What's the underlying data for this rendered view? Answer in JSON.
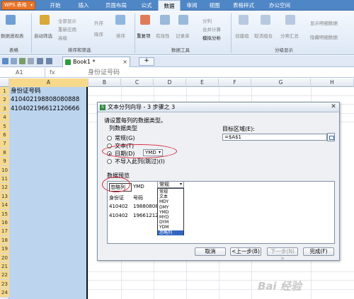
{
  "menubar": {
    "wps_button": "WPS 表格",
    "tabs": [
      "开始",
      "插入",
      "页面布局",
      "公式",
      "数据",
      "审阅",
      "视图",
      "表格样式",
      "办公空间"
    ],
    "active_tab": "数据"
  },
  "ribbon": {
    "items": {
      "pivot": "数据透视表",
      "autofilter": "自动筛选",
      "show_all": "全部显示",
      "reapply": "重新应用",
      "advanced": "高级",
      "sort_asc": "升序",
      "sort_desc": "降序",
      "sort": "排序",
      "duplicates": "重复项",
      "validation": "有效性",
      "record": "记录单",
      "split": "分列",
      "consolidate": "合并计算",
      "whatif": "模拟分析",
      "group": "创建组",
      "ungroup": "取消组合",
      "subtotal": "分类汇总",
      "show_detail": "显示明细数据",
      "hide_detail": "隐藏明细数据"
    },
    "groups": {
      "table": "表格",
      "sort_filter": "排序和筛选",
      "data_tools": "数据工具",
      "outline": "分级显示"
    }
  },
  "tabbar": {
    "doc_tab": "Book1 *",
    "close": "×",
    "new_tab": "+"
  },
  "formula": {
    "namebox": "A1",
    "fx": "fx",
    "content": "身份证号码"
  },
  "grid": {
    "columns": [
      "A",
      "B",
      "C",
      "D",
      "E",
      "F",
      "G",
      "H"
    ],
    "rows": [
      "1",
      "2",
      "3",
      "4",
      "5",
      "6",
      "7",
      "8",
      "9",
      "10",
      "11",
      "12",
      "13",
      "14",
      "15",
      "16",
      "17",
      "18",
      "19",
      "20",
      "21",
      "22",
      "23",
      "24"
    ],
    "cells": [
      "身份证号码",
      "410402198808080888",
      "410402196612120666"
    ]
  },
  "dialog": {
    "title": "文本分列向导 - 3 步骤之 3",
    "instruction": "请设置每列的数据类型。",
    "coltype_label": "列数据类型",
    "options": [
      "常规(G)",
      "文本(T)",
      "日期(D)",
      "不导入此列(跳过)(I)"
    ],
    "selected_option": "日期(D)",
    "date_format": "YMD",
    "target_label": "目标区域(E):",
    "target_value": "=$A$1",
    "preview_label": "数据预览",
    "preview": {
      "col1_header": "忽略列",
      "col2_header": "YMD",
      "col3_header": "常规",
      "row_header": [
        "身份证",
        "号码"
      ],
      "rows": [
        [
          "410402",
          "19880808"
        ],
        [
          "410402",
          "19661212"
        ]
      ]
    },
    "dropdown_items": [
      "常规",
      "文本",
      "MDY",
      "DMY",
      "YMD",
      "MYD",
      "DYM",
      "YDM",
      "忽略列"
    ],
    "dropdown_selected": "忽略列",
    "buttons": {
      "cancel": "取消",
      "back": "<上一步(B)",
      "next": "下一步(N) >",
      "finish": "完成(F)"
    }
  },
  "watermark": "Bai 经验"
}
